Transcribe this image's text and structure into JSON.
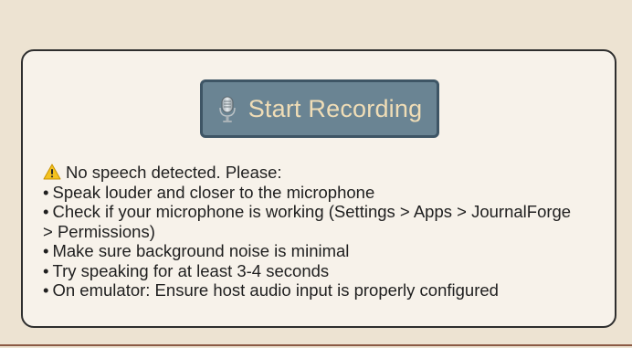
{
  "record_button": {
    "label": "Start Recording",
    "icon": "microphone-icon",
    "background": "#6a8493",
    "border": "#3e5565",
    "text_color": "#f0ddb6"
  },
  "message": {
    "icon": "warning-icon",
    "heading": "No speech detected. Please:",
    "bullet_char": "•",
    "lines": [
      "Speak louder and closer to the microphone",
      "Check if your microphone is working (Settings > Apps > JournalForge",
      "> Permissions)",
      "Make sure background noise is minimal",
      "Try speaking for at least 3-4 seconds",
      "On emulator: Ensure host audio input is properly configured"
    ]
  },
  "colors": {
    "page_background": "#ede3d2",
    "card_background": "#f7f2ea",
    "card_border": "#2e2e2e",
    "bottom_divider": "#8b5a44"
  }
}
